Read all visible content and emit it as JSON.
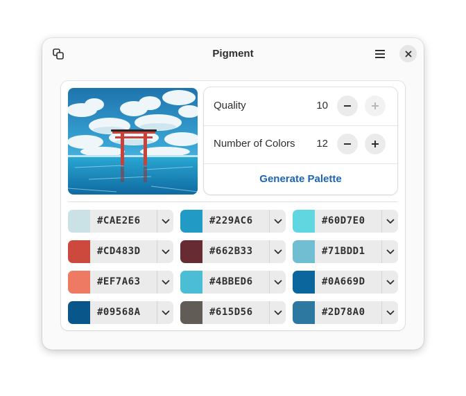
{
  "window": {
    "title": "Pigment"
  },
  "icons": {
    "copy": "copy-icon",
    "menu": "hamburger-menu-icon",
    "close": "close-icon",
    "minus": "minus-icon",
    "plus": "plus-icon",
    "dropdown": "chevron-down-icon"
  },
  "settings": {
    "quality_label": "Quality",
    "quality_value": "10",
    "colors_label": "Number of Colors",
    "colors_value": "12",
    "generate_label": "Generate Palette"
  },
  "palette": [
    {
      "hex": "#CAE2E6",
      "color": "#CAE2E6"
    },
    {
      "hex": "#229AC6",
      "color": "#229AC6"
    },
    {
      "hex": "#60D7E0",
      "color": "#60D7E0"
    },
    {
      "hex": "#CD483D",
      "color": "#CD483D"
    },
    {
      "hex": "#662B33",
      "color": "#662B33"
    },
    {
      "hex": "#71BDD1",
      "color": "#71BDD1"
    },
    {
      "hex": "#EF7A63",
      "color": "#EF7A63"
    },
    {
      "hex": "#4BBED6",
      "color": "#4BBED6"
    },
    {
      "hex": "#0A669D",
      "color": "#0A669D"
    },
    {
      "hex": "#09568A",
      "color": "#09568A"
    },
    {
      "hex": "#615D56",
      "color": "#615D56"
    },
    {
      "hex": "#2D78A0",
      "color": "#2D78A0"
    }
  ],
  "accent_color": "#1c64b8"
}
